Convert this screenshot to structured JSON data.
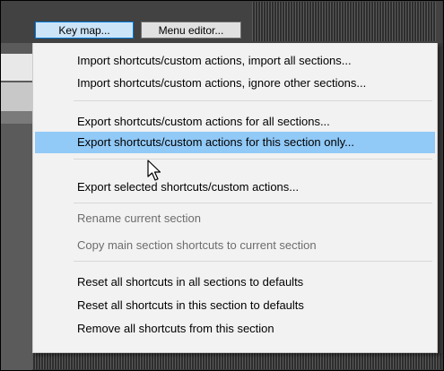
{
  "toolbar": {
    "key_map_label": "Key map...",
    "menu_editor_label": "Menu editor..."
  },
  "menu": {
    "items": [
      {
        "label": "Import shortcuts/custom actions, import all sections...",
        "enabled": true
      },
      {
        "label": "Import shortcuts/custom actions, ignore other sections...",
        "enabled": true
      },
      {
        "label": "Export shortcuts/custom actions for all sections...",
        "enabled": true
      },
      {
        "label": "Export shortcuts/custom actions for this section only...",
        "enabled": true,
        "highlighted": true
      },
      {
        "label": "Export selected shortcuts/custom actions...",
        "enabled": true
      },
      {
        "label": "Rename current section",
        "enabled": false
      },
      {
        "label": "Copy main section shortcuts to current section",
        "enabled": false
      },
      {
        "label": "Reset all shortcuts in all sections to defaults",
        "enabled": true
      },
      {
        "label": "Reset all shortcuts in this section to defaults",
        "enabled": true
      },
      {
        "label": "Remove all shortcuts from this section",
        "enabled": true
      }
    ]
  },
  "colors": {
    "highlight": "#91c9f7",
    "menu_background": "#f2f2f2",
    "disabled_text": "#6d6d6d"
  },
  "icons": {
    "cursor": "arrow-pointer-icon"
  }
}
